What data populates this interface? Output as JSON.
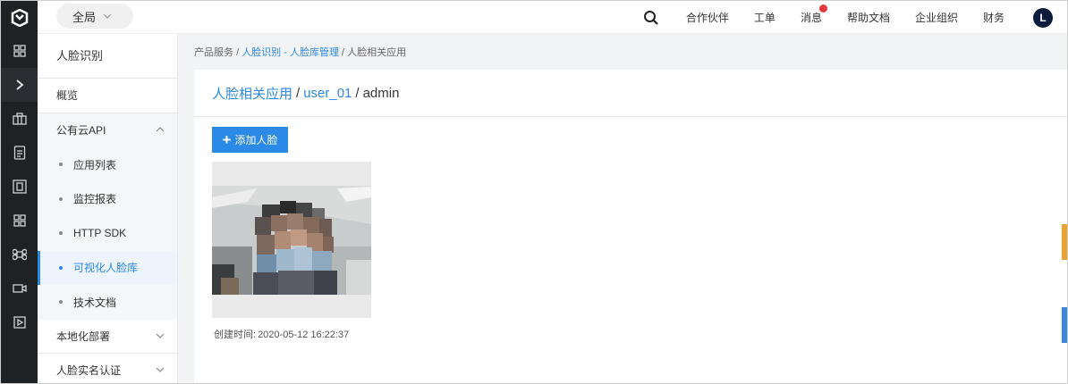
{
  "topbar": {
    "scope_label": "全局",
    "nav": [
      "合作伙伴",
      "工单",
      "消息",
      "帮助文档",
      "企业组织",
      "财务"
    ],
    "avatar_letter": "L"
  },
  "sidebar": {
    "title": "人脸识别",
    "overview": "概览",
    "group_public": "公有云API",
    "sub_items": [
      "应用列表",
      "监控报表",
      "HTTP SDK",
      "可视化人脸库",
      "技术文档"
    ],
    "group_local": "本地化部署",
    "group_realname": "人脸实名认证"
  },
  "breadcrumb": {
    "root": "产品服务",
    "link": "人脸识别 - 人脸库管理",
    "current": "人脸相关应用"
  },
  "panel": {
    "title_link_1": "人脸相关应用",
    "title_link_2": "user_01",
    "title_current": "admin",
    "add_button": "添加人脸",
    "created_label": "创建时间:",
    "created_value": "2020-05-12 16:22:37"
  },
  "colors": {
    "accent": "#2b89e8",
    "rail": "#1f2225",
    "badge": "#e4393c"
  },
  "icons": [
    "logo-icon",
    "chevron-down-icon",
    "search-icon",
    "grid-icon",
    "expand-icon",
    "building-icon",
    "document-icon",
    "scan-icon",
    "apps-icon",
    "command-icon",
    "camera-icon",
    "play-icon",
    "plus-icon"
  ]
}
